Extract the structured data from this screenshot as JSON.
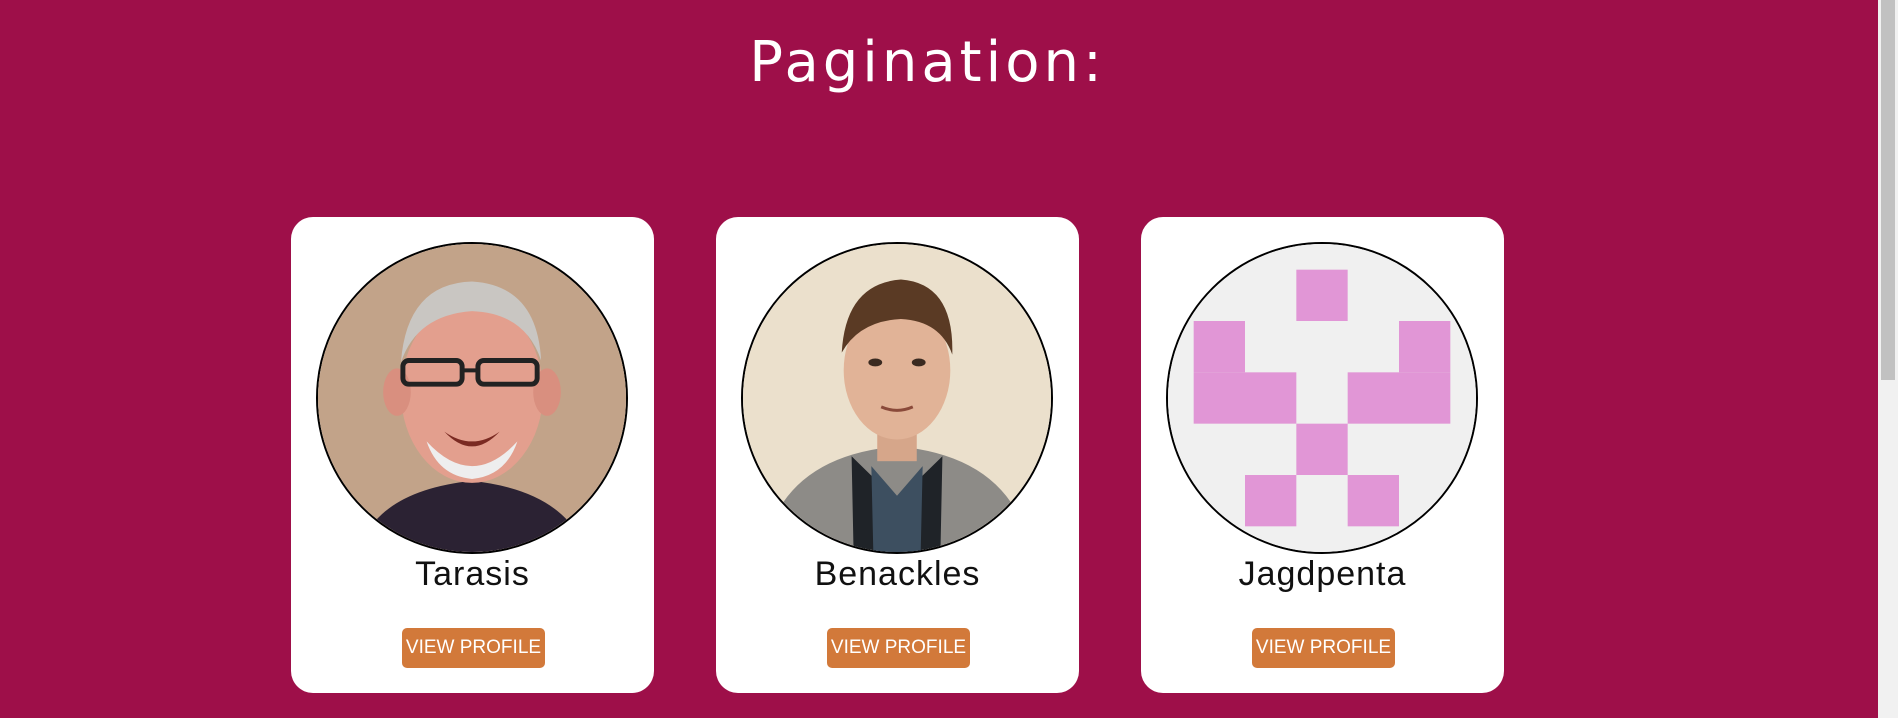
{
  "page": {
    "title": "Pagination:",
    "background_color": "#9e0f49",
    "button_color": "#d2793a"
  },
  "profiles": [
    {
      "name": "Tarasis",
      "button_label": "VIEW PROFILE",
      "avatar": "photo"
    },
    {
      "name": "Benackles",
      "button_label": "VIEW PROFILE",
      "avatar": "photo"
    },
    {
      "name": "Jagdpenta",
      "button_label": "VIEW PROFILE",
      "avatar": "identicon",
      "identicon_color": "#e196d6"
    }
  ]
}
